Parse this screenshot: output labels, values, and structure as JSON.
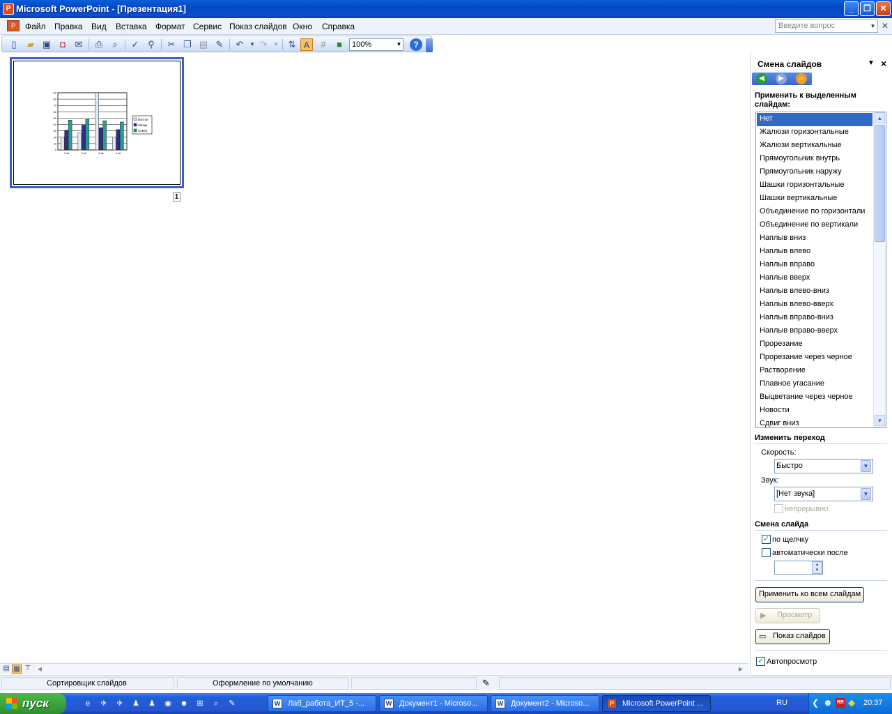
{
  "window": {
    "title": "Microsoft PowerPoint - [Презентация1]"
  },
  "menu": {
    "items": [
      "Файл",
      "Правка",
      "Вид",
      "Вставка",
      "Формат",
      "Сервис",
      "Показ слайдов",
      "Окно",
      "Справка"
    ],
    "ask_placeholder": "Введите вопрос"
  },
  "toolbar": {
    "zoom": "100%"
  },
  "slide": {
    "number": "1",
    "chart_data": {
      "type": "bar",
      "categories": [
        "1 кв",
        "2 кв",
        "3 кв",
        "4 кв"
      ],
      "series": [
        {
          "name": "Восток",
          "values": [
            20,
            27,
            90,
            20
          ],
          "color": "#dde8f0"
        },
        {
          "name": "Запад",
          "values": [
            31,
            39,
            35,
            32
          ],
          "color": "#2e2e8a"
        },
        {
          "name": "Север",
          "values": [
            47,
            48,
            46,
            44
          ],
          "color": "#2a9c90"
        }
      ],
      "ylim": [
        0,
        90
      ],
      "yticks": [
        "90",
        "80",
        "70",
        "60",
        "50",
        "40",
        "30",
        "20",
        "10",
        "0"
      ],
      "legend": "right"
    }
  },
  "taskpane": {
    "title": "Смена слайдов",
    "apply_label": "Применить к выделенным слайдам:",
    "transitions": [
      "Нет",
      "Жалюзи горизонтальные",
      "Жалюзи вертикальные",
      "Прямоугольник внутрь",
      "Прямоугольник наружу",
      "Шашки горизонтальные",
      "Шашки вертикальные",
      "Объединение по горизонтали",
      "Объединение по вертикали",
      "Наплыв вниз",
      "Наплыв влево",
      "Наплыв вправо",
      "Наплыв вверх",
      "Наплыв влево-вниз",
      "Наплыв влево-вверх",
      "Наплыв вправо-вниз",
      "Наплыв вправо-вверх",
      "Прорезание",
      "Прорезание через черное",
      "Растворение",
      "Плавное угасание",
      "Выцветание через черное",
      "Новости",
      "Сдвиг вниз"
    ],
    "selected_transition": "Нет",
    "modify_section": "Изменить переход",
    "speed_label": "Скорость:",
    "speed_value": "Быстро",
    "sound_label": "Звук:",
    "sound_value": "[Нет звука]",
    "loop_label": "непрерывно",
    "advance_section": "Смена слайда",
    "on_click_label": "по щелчку",
    "on_click_checked": true,
    "auto_after_label": "автоматически после",
    "auto_after_checked": false,
    "apply_all_button": "Применить ко всем слайдам",
    "preview_button": "Просмотр",
    "slideshow_button": "Показ слайдов",
    "autopreview_label": "Автопросмотр",
    "autopreview_checked": true
  },
  "status": {
    "view": "Сортировщик слайдов",
    "design": "Оформление по умолчанию"
  },
  "taskbar": {
    "start": "пуск",
    "buttons": [
      "Лаб_работа_ИТ_5 -...",
      "Документ1 - Microso...",
      "Документ2 - Microso...",
      "Microsoft PowerPoint ..."
    ],
    "active_button": 3,
    "lang": "RU",
    "clock": "20:37"
  }
}
